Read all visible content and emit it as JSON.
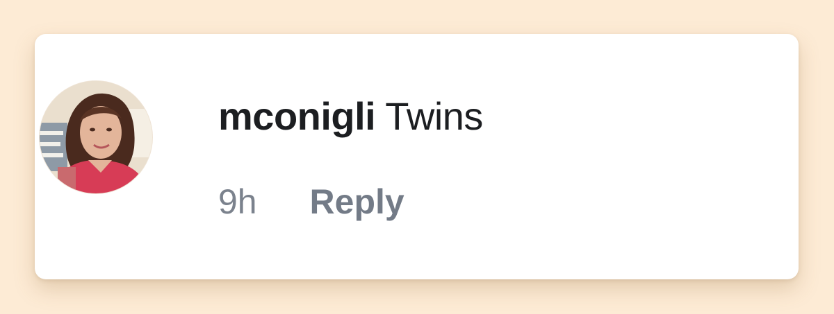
{
  "comment": {
    "username": "mconigli",
    "text": "Twins",
    "timestamp": "9h",
    "reply_label": "Reply"
  },
  "avatar": {
    "icon": "user-avatar-photo",
    "colors": {
      "background": "#e9dccb",
      "hair": "#4a2a1e",
      "skin": "#e3b59a",
      "shirt": "#d73c56"
    }
  },
  "theme": {
    "page_background": "#fdebd5",
    "card_background": "#ffffff",
    "text_primary": "#1c1e21",
    "text_secondary": "#7b828d"
  }
}
